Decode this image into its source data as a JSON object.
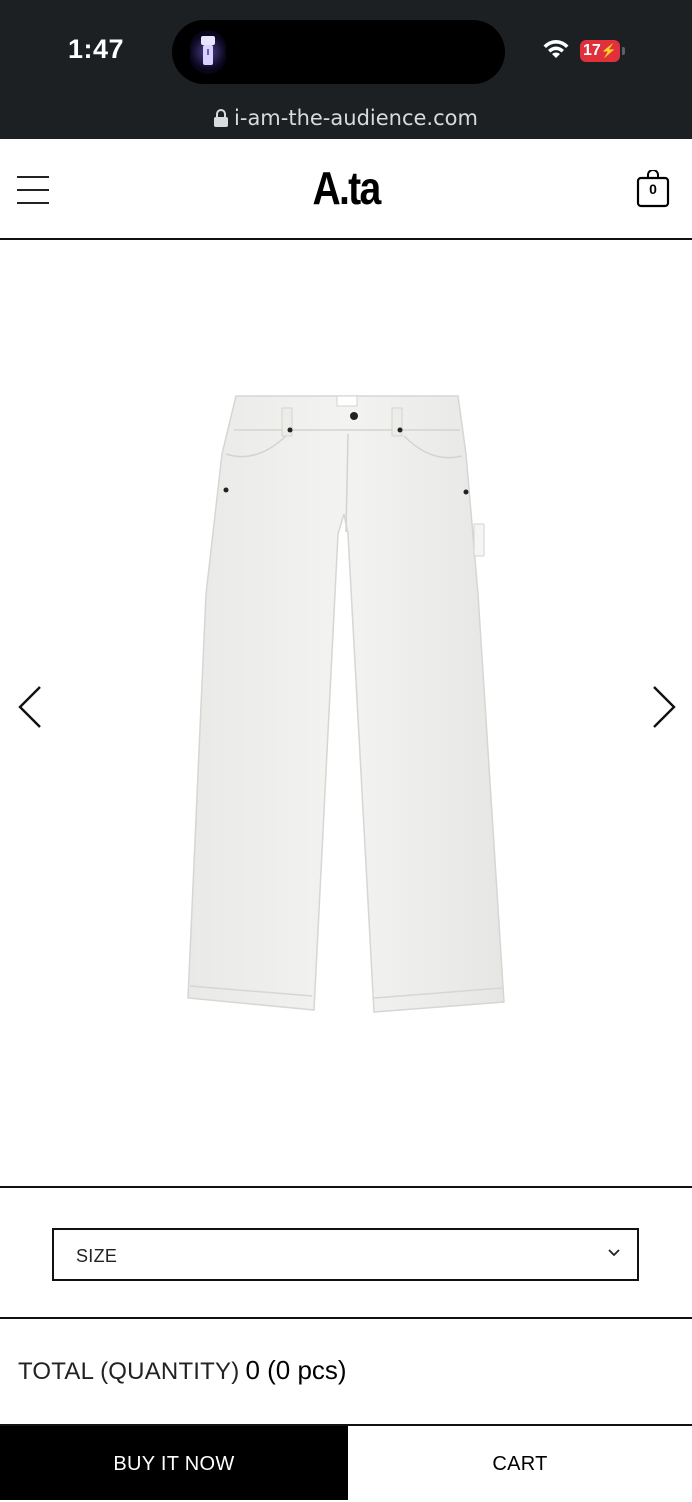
{
  "status_bar": {
    "time": "1:47",
    "battery": "17",
    "url": "i-am-the-audience.com",
    "icons": [
      "flashlight-icon",
      "wifi-icon",
      "battery-icon",
      "lock-icon"
    ]
  },
  "header": {
    "logo": "A.ta",
    "cart_count": "0",
    "icons": [
      "menu-icon",
      "cart-icon"
    ]
  },
  "gallery": {
    "image_alt": "white painter pants",
    "icons": [
      "chevron-left-icon",
      "chevron-right-icon"
    ]
  },
  "options": {
    "size_placeholder": "SIZE"
  },
  "total": {
    "label": "TOTAL (QUANTITY)",
    "value": "0 (0 pcs)"
  },
  "actions": {
    "buy_now": "BUY IT NOW",
    "cart": "CART"
  },
  "colors": {
    "status_bg": "#1d2023",
    "battery_red": "#e0303c",
    "buy_bg": "#000000",
    "border": "#111111"
  }
}
